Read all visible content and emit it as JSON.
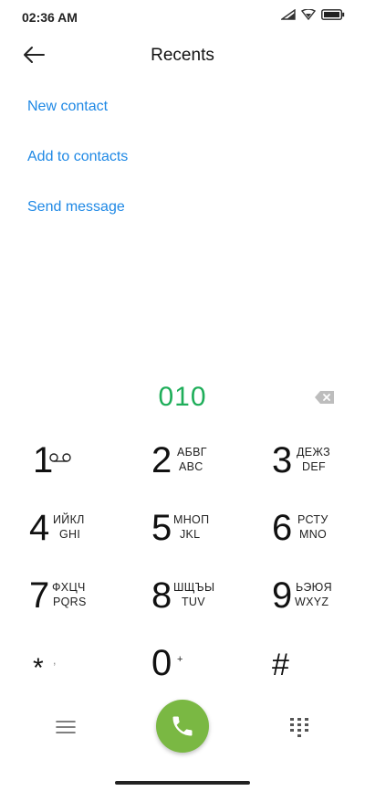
{
  "status_bar": {
    "time": "02:36 AM",
    "icons": [
      "signal-icon",
      "wifi-icon",
      "battery-icon"
    ]
  },
  "header": {
    "title": "Recents",
    "back_icon": "arrow-left-icon"
  },
  "actions": {
    "new_contact": "New contact",
    "add_to_contacts": "Add to contacts",
    "send_message": "Send message"
  },
  "dialer": {
    "number": "010",
    "number_color": "#1fae5a",
    "keys": [
      {
        "digit": "1",
        "l1": "",
        "l2": ""
      },
      {
        "digit": "2",
        "l1": "АБВГ",
        "l2": "ABC"
      },
      {
        "digit": "3",
        "l1": "ДЕЖЗ",
        "l2": "DEF"
      },
      {
        "digit": "4",
        "l1": "ИЙКЛ",
        "l2": "GHI"
      },
      {
        "digit": "5",
        "l1": "МНОП",
        "l2": "JKL"
      },
      {
        "digit": "6",
        "l1": "РСТУ",
        "l2": "MNO"
      },
      {
        "digit": "7",
        "l1": "ФХЦЧ",
        "l2": "PQRS"
      },
      {
        "digit": "8",
        "l1": "ШЩЪЫ",
        "l2": "TUV"
      },
      {
        "digit": "9",
        "l1": "ЬЭЮЯ",
        "l2": "WXYZ"
      },
      {
        "digit": "*",
        "l1": ",",
        "l2": ""
      },
      {
        "digit": "0",
        "l1": "+",
        "l2": ""
      },
      {
        "digit": "#",
        "l1": "",
        "l2": ""
      }
    ]
  },
  "bottom_bar": {
    "menu_icon": "menu-icon",
    "call_icon": "phone-icon",
    "call_color": "#7ab843",
    "dialpad_icon": "dialpad-icon"
  }
}
